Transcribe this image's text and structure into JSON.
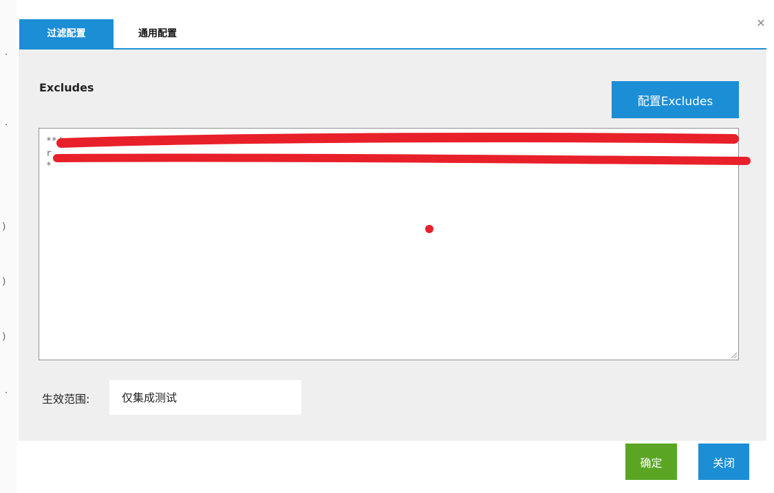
{
  "dialog": {
    "close_icon": "close-icon",
    "tabs": [
      {
        "label": "过滤配置",
        "active": true
      },
      {
        "label": "通用配置",
        "active": false
      }
    ],
    "excludes": {
      "section_label": "Excludes",
      "config_button_label": "配置Excludes",
      "textarea_lines": [
        "**/",
        "r",
        "*"
      ]
    },
    "scope": {
      "label": "生效范围:",
      "value": "仅集成测试"
    },
    "footer": {
      "ok_label": "确定",
      "close_label": "关闭"
    }
  },
  "colors": {
    "accent_blue": "#1b8ed6",
    "ok_green": "#5aa624",
    "panel_bg": "#efefef",
    "redaction_red": "#e8202a"
  }
}
